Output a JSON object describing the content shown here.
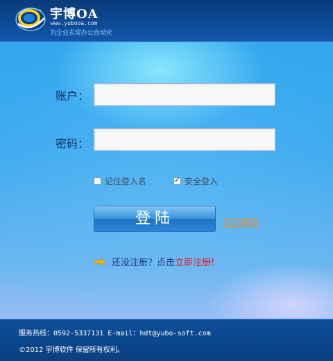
{
  "header": {
    "brand_title": "宇博OA",
    "brand_url": "www.yubooa.com",
    "brand_slogan": "为企业实现办公自动化",
    "logo_icon": "swirl-globe-logo-icon"
  },
  "login": {
    "account_label": "账户：",
    "password_label": "密码：",
    "account_value": "",
    "password_value": "",
    "remember_label": "记住登入名",
    "remember_checked": false,
    "secure_label": "安全登入",
    "secure_checked": true,
    "login_button": "登陆",
    "forgot_link": "忘记密码",
    "register_prompt": "还没注册？点击",
    "register_link": "立即注册!",
    "arrow_icon": "right-arrow-icon"
  },
  "footer": {
    "hotline_label": "服务热线：",
    "hotline_value": "0592-5337131 E-mail：hdt@yubo-soft.com",
    "copyright": "©2012 宇博软件 保留所有权利。"
  },
  "colors": {
    "header_bg": "#0c4a94",
    "label_text": "#12326a",
    "forgot_link": "#f08a1c",
    "register_link": "#e8101a",
    "button_blue": "#3894dc"
  }
}
